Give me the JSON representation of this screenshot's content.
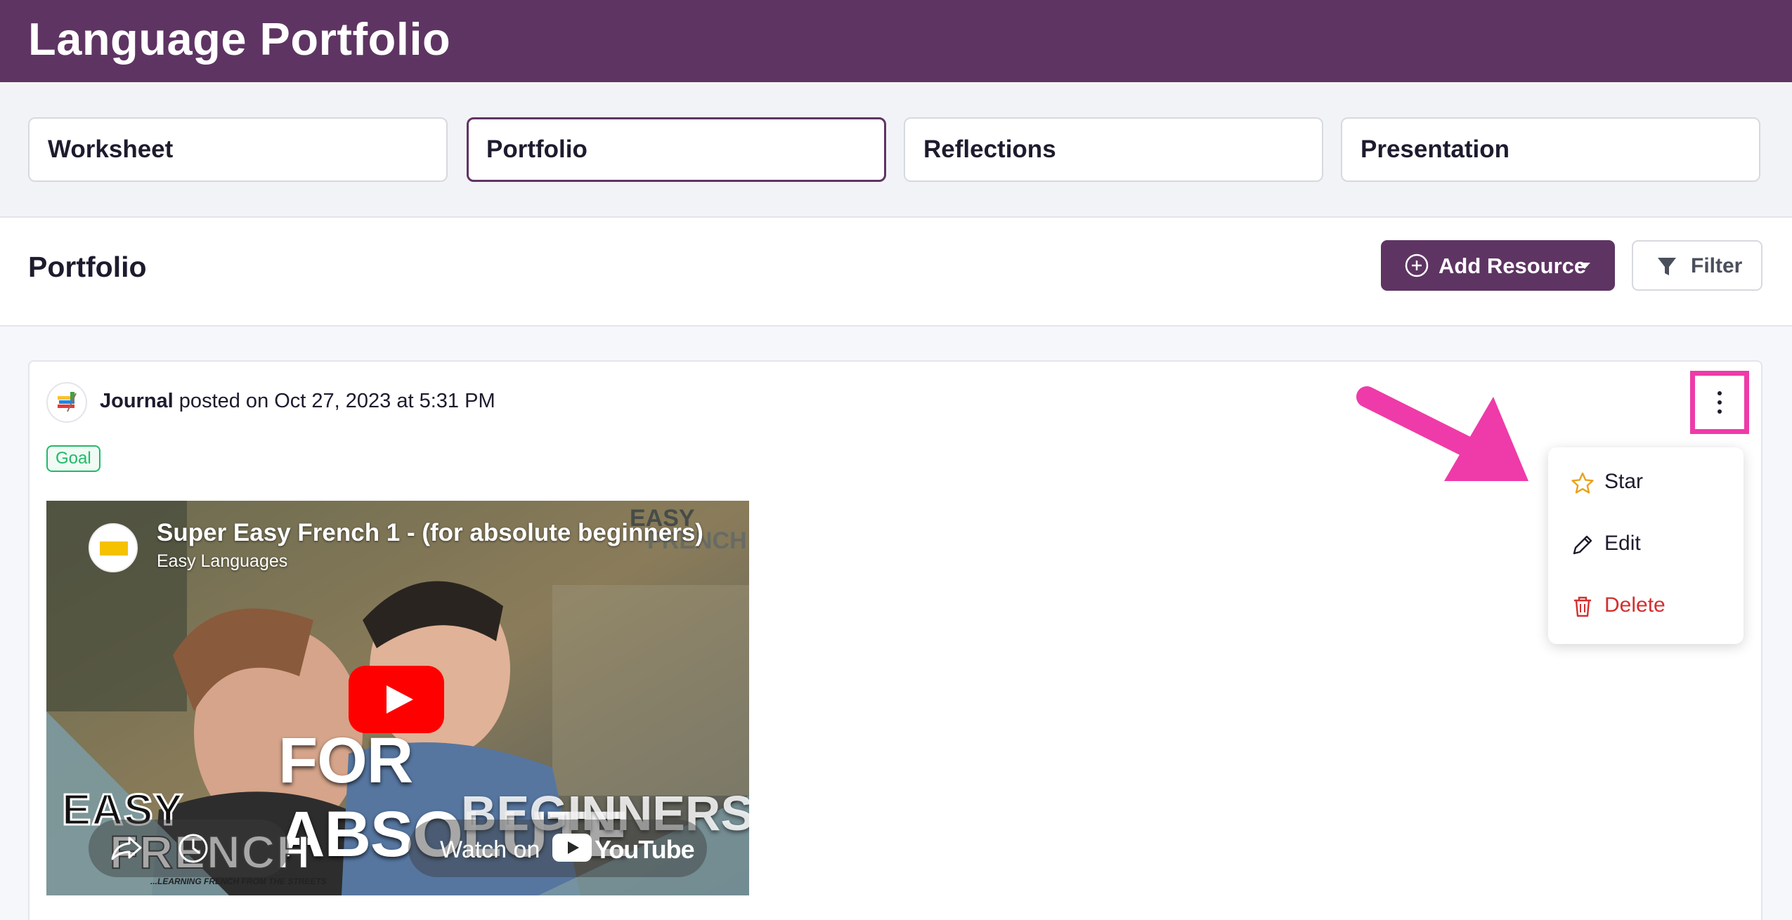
{
  "app": {
    "title": "Language Portfolio"
  },
  "tabs": [
    {
      "label": "Worksheet",
      "active": false
    },
    {
      "label": "Portfolio",
      "active": true
    },
    {
      "label": "Reflections",
      "active": false
    },
    {
      "label": "Presentation",
      "active": false
    }
  ],
  "section": {
    "title": "Portfolio",
    "add_button": "Add Resource",
    "filter_button": "Filter"
  },
  "post": {
    "author": "Journal",
    "meta": " posted on Oct 27, 2023 at 5:31 PM",
    "tag": "Goal",
    "video": {
      "title": "Super Easy French 1 - (for absolute beginners)",
      "channel": "Easy Languages",
      "overlay_line1": "FOR ABSOLUTE",
      "overlay_line2": "BEGINNERS",
      "brand_line1": "EASY",
      "brand_line2": "FRENCH",
      "brand_tagline": "...LEARNING FRENCH FROM THE STREETS",
      "watermark_line1": "EASY",
      "watermark_line2": "FRENCH",
      "watch_on": "Watch on",
      "platform": "YouTube"
    }
  },
  "menu": {
    "items": [
      {
        "label": "Star",
        "icon": "star-icon",
        "color": "#1e1b2e"
      },
      {
        "label": "Edit",
        "icon": "pencil-icon",
        "color": "#1e1b2e"
      },
      {
        "label": "Delete",
        "icon": "trash-icon",
        "color": "#d32f2f"
      }
    ]
  },
  "colors": {
    "brand": "#5e3463",
    "highlight": "#ee3ba9",
    "tag_green": "#21b969",
    "danger": "#d32f2f",
    "star": "#e9a21a"
  }
}
